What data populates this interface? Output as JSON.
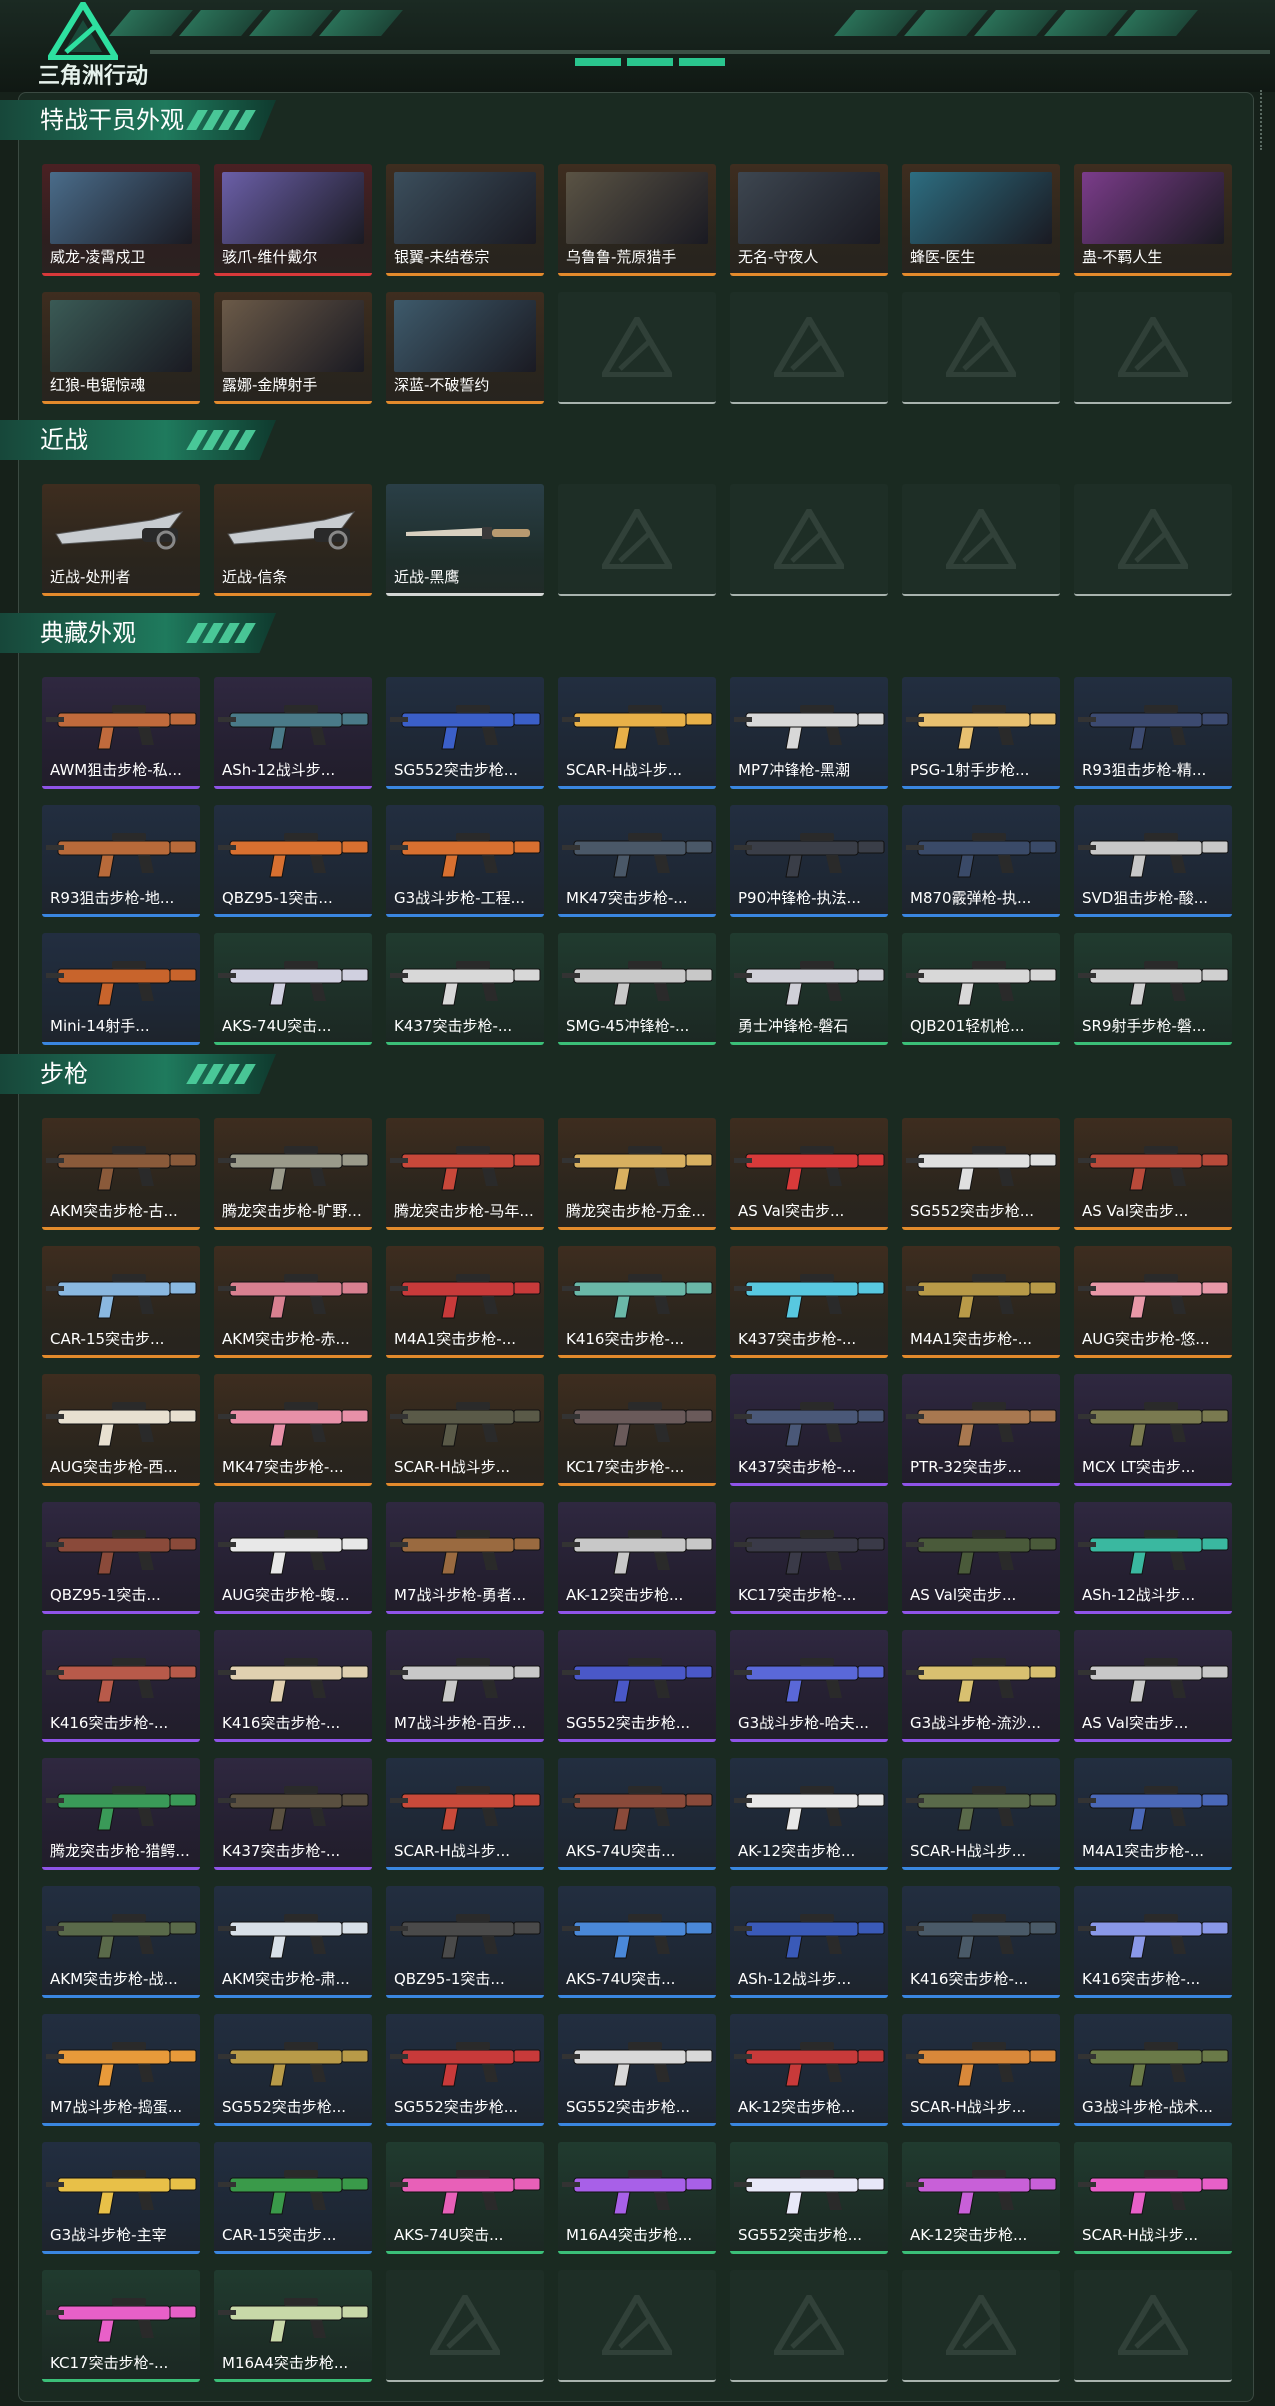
{
  "header": {
    "logo_text": "三角洲行动"
  },
  "sections": [
    {
      "title": "特战干员外观",
      "items": [
        {
          "name": "威龙-凌霄戍卫",
          "rarity": "red",
          "art": "#4a6c8a"
        },
        {
          "name": "骇爪-维什戴尔",
          "rarity": "red",
          "art": "#6b5fa8"
        },
        {
          "name": "银翼-未结卷宗",
          "rarity": "gold",
          "art": "#3b4e5c"
        },
        {
          "name": "乌鲁鲁-荒原猎手",
          "rarity": "gold",
          "art": "#5a5344"
        },
        {
          "name": "无名-守夜人",
          "rarity": "gold",
          "art": "#3d4650"
        },
        {
          "name": "蜂医-医生",
          "rarity": "gold",
          "art": "#2d6d80"
        },
        {
          "name": "蛊-不羁人生",
          "rarity": "gold",
          "art": "#7b3c8a"
        },
        {
          "name": "红狼-电锯惊魂",
          "rarity": "gold",
          "art": "#3a5a55"
        },
        {
          "name": "露娜-金牌射手",
          "rarity": "gold",
          "art": "#6b5a48"
        },
        {
          "name": "深蓝-不破誓约",
          "rarity": "gold",
          "art": "#3e5a6b"
        },
        null,
        null,
        null,
        null
      ]
    },
    {
      "title": "近战",
      "items": [
        {
          "name": "近战-处刑者",
          "rarity": "gold",
          "gun": "blade"
        },
        {
          "name": "近战-信条",
          "rarity": "gold",
          "gun": "blade"
        },
        {
          "name": "近战-黑鹰",
          "rarity": "white",
          "gun": "knife"
        },
        null,
        null,
        null,
        null
      ]
    },
    {
      "title": "典藏外观",
      "items": [
        {
          "name": "AWM狙击步枪-私...",
          "rarity": "purple",
          "color": "#c06a3c"
        },
        {
          "name": "ASh-12战斗步...",
          "rarity": "purple",
          "color": "#4a7a88"
        },
        {
          "name": "SG552突击步枪...",
          "rarity": "blue",
          "color": "#3b5fc8"
        },
        {
          "name": "SCAR-H战斗步...",
          "rarity": "blue",
          "color": "#e8b048"
        },
        {
          "name": "MP7冲锋枪-黑潮",
          "rarity": "blue",
          "color": "#d8d8d8"
        },
        {
          "name": "PSG-1射手步枪...",
          "rarity": "blue",
          "color": "#e8c070"
        },
        {
          "name": "R93狙击步枪-精...",
          "rarity": "blue",
          "color": "#3c4a70"
        },
        {
          "name": "R93狙击步枪-地...",
          "rarity": "blue",
          "color": "#b86a3a"
        },
        {
          "name": "QBZ95-1突击...",
          "rarity": "blue",
          "color": "#d87030"
        },
        {
          "name": "G3战斗步枪-工程...",
          "rarity": "blue",
          "color": "#d87030"
        },
        {
          "name": "MK47突击步枪-...",
          "rarity": "blue",
          "color": "#4a5868"
        },
        {
          "name": "P90冲锋枪-执法...",
          "rarity": "blue",
          "color": "#3a3e48"
        },
        {
          "name": "M870霰弹枪-执...",
          "rarity": "blue",
          "color": "#3a4a68"
        },
        {
          "name": "SVD狙击步枪-酸...",
          "rarity": "blue",
          "color": "#c8c8c8"
        },
        {
          "name": "Mini-14射手...",
          "rarity": "blue",
          "color": "#c8642c"
        },
        {
          "name": "AKS-74U突击...",
          "rarity": "green",
          "color": "#d0d0e0"
        },
        {
          "name": "K437突击步枪-...",
          "rarity": "green",
          "color": "#d8d8d8"
        },
        {
          "name": "SMG-45冲锋枪-...",
          "rarity": "green",
          "color": "#c8c8c8"
        },
        {
          "name": "勇士冲锋枪-磐石",
          "rarity": "green",
          "color": "#d0d0d8"
        },
        {
          "name": "QJB201轻机枪...",
          "rarity": "green",
          "color": "#d8d8d8"
        },
        {
          "name": "SR9射手步枪-磐...",
          "rarity": "green",
          "color": "#d0d0d0"
        }
      ]
    },
    {
      "title": "步枪",
      "items": [
        {
          "name": "AKM突击步枪-古...",
          "rarity": "gold",
          "color": "#8a5a3a"
        },
        {
          "name": "腾龙突击步枪-旷野...",
          "rarity": "gold",
          "color": "#9a9a8a"
        },
        {
          "name": "腾龙突击步枪-马年...",
          "rarity": "gold",
          "color": "#c8483a"
        },
        {
          "name": "腾龙突击步枪-万金...",
          "rarity": "gold",
          "color": "#d8b060"
        },
        {
          "name": "AS Val突击步...",
          "rarity": "gold",
          "color": "#d83a3a"
        },
        {
          "name": "SG552突击步枪...",
          "rarity": "gold",
          "color": "#e0e0e0"
        },
        {
          "name": "AS Val突击步...",
          "rarity": "gold",
          "color": "#b84a3a"
        },
        {
          "name": "CAR-15突击步...",
          "rarity": "gold",
          "color": "#8ab8e0"
        },
        {
          "name": "AKM突击步枪-赤...",
          "rarity": "gold",
          "color": "#d88090"
        },
        {
          "name": "M4A1突击步枪-...",
          "rarity": "gold",
          "color": "#c83a3a"
        },
        {
          "name": "K416突击步枪-...",
          "rarity": "gold",
          "color": "#6ab8a8"
        },
        {
          "name": "K437突击步枪-...",
          "rarity": "gold",
          "color": "#58c8e0"
        },
        {
          "name": "M4A1突击步枪-...",
          "rarity": "gold",
          "color": "#b89a48"
        },
        {
          "name": "AUG突击步枪-悠...",
          "rarity": "gold",
          "color": "#e898a8"
        },
        {
          "name": "AUG突击步枪-西...",
          "rarity": "gold",
          "color": "#e8e0d0"
        },
        {
          "name": "MK47突击步枪-...",
          "rarity": "gold",
          "color": "#e890a8"
        },
        {
          "name": "SCAR-H战斗步...",
          "rarity": "gold",
          "color": "#5a5a48"
        },
        {
          "name": "KC17突击步枪-...",
          "rarity": "gold",
          "color": "#6a5a5a"
        },
        {
          "name": "K437突击步枪-...",
          "rarity": "purple",
          "color": "#4a5878"
        },
        {
          "name": "PTR-32突击步...",
          "rarity": "purple",
          "color": "#a87850"
        },
        {
          "name": "MCX LT突击步...",
          "rarity": "purple",
          "color": "#7a7a50"
        },
        {
          "name": "QBZ95-1突击...",
          "rarity": "purple",
          "color": "#8a4a3a"
        },
        {
          "name": "AUG突击步枪-蝮...",
          "rarity": "purple",
          "color": "#e8e8e8"
        },
        {
          "name": "M7战斗步枪-勇者...",
          "rarity": "purple",
          "color": "#9a6a40"
        },
        {
          "name": "AK-12突击步枪...",
          "rarity": "purple",
          "color": "#c8c8c8"
        },
        {
          "name": "KC17突击步枪-...",
          "rarity": "purple",
          "color": "#3a3a48"
        },
        {
          "name": "AS Val突击步...",
          "rarity": "purple",
          "color": "#4a5a3a"
        },
        {
          "name": "ASh-12战斗步...",
          "rarity": "purple",
          "color": "#3ab8a0"
        },
        {
          "name": "K416突击步枪-...",
          "rarity": "purple",
          "color": "#b85a4a"
        },
        {
          "name": "K416突击步枪-...",
          "rarity": "purple",
          "color": "#e0d0b0"
        },
        {
          "name": "M7战斗步枪-百步...",
          "rarity": "purple",
          "color": "#c8c8c8"
        },
        {
          "name": "SG552突击步枪...",
          "rarity": "purple",
          "color": "#4a58c8"
        },
        {
          "name": "G3战斗步枪-哈夫...",
          "rarity": "purple",
          "color": "#5a68d8"
        },
        {
          "name": "G3战斗步枪-流沙...",
          "rarity": "purple",
          "color": "#d8c070"
        },
        {
          "name": "AS Val突击步...",
          "rarity": "purple",
          "color": "#c8c8c8"
        },
        {
          "name": "腾龙突击步枪-猎鳄...",
          "rarity": "purple",
          "color": "#3a9a58"
        },
        {
          "name": "K437突击步枪-...",
          "rarity": "purple",
          "color": "#5a5040"
        },
        {
          "name": "SCAR-H战斗步...",
          "rarity": "blue",
          "color": "#c84a3a"
        },
        {
          "name": "AKS-74U突击...",
          "rarity": "blue",
          "color": "#8a4a3a"
        },
        {
          "name": "AK-12突击步枪...",
          "rarity": "blue",
          "color": "#e8e8e8"
        },
        {
          "name": "SCAR-H战斗步...",
          "rarity": "blue",
          "color": "#5a6a4a"
        },
        {
          "name": "M4A1突击步枪-...",
          "rarity": "blue",
          "color": "#4a68b8"
        },
        {
          "name": "AKM突击步枪-战...",
          "rarity": "blue",
          "color": "#5a6a4a"
        },
        {
          "name": "AKM突击步枪-肃...",
          "rarity": "blue",
          "color": "#d8e0e8"
        },
        {
          "name": "QBZ95-1突击...",
          "rarity": "blue",
          "color": "#4a4a4a"
        },
        {
          "name": "AKS-74U突击...",
          "rarity": "blue",
          "color": "#4a88d8"
        },
        {
          "name": "ASh-12战斗步...",
          "rarity": "blue",
          "color": "#3a5ab8"
        },
        {
          "name": "K416突击步枪-...",
          "rarity": "blue",
          "color": "#4a5a68"
        },
        {
          "name": "K416突击步枪-...",
          "rarity": "blue",
          "color": "#8a98e8"
        },
        {
          "name": "M7战斗步枪-捣蛋...",
          "rarity": "blue",
          "color": "#e89a3a"
        },
        {
          "name": "SG552突击步枪...",
          "rarity": "blue",
          "color": "#b89a48"
        },
        {
          "name": "SG552突击步枪...",
          "rarity": "blue",
          "color": "#c83a3a"
        },
        {
          "name": "SG552突击步枪...",
          "rarity": "blue",
          "color": "#d8d8d8"
        },
        {
          "name": "AK-12突击步枪...",
          "rarity": "blue",
          "color": "#c83a3a"
        },
        {
          "name": "SCAR-H战斗步...",
          "rarity": "blue",
          "color": "#d8883a"
        },
        {
          "name": "G3战斗步枪-战术...",
          "rarity": "blue",
          "color": "#6a7a48"
        },
        {
          "name": "G3战斗步枪-主宰",
          "rarity": "blue",
          "color": "#e8c048"
        },
        {
          "name": "CAR-15突击步...",
          "rarity": "blue",
          "color": "#3a9a4a"
        },
        {
          "name": "AKS-74U突击...",
          "rarity": "green",
          "color": "#e860b8"
        },
        {
          "name": "M16A4突击步枪...",
          "rarity": "green",
          "color": "#a860e8"
        },
        {
          "name": "SG552突击步枪...",
          "rarity": "green",
          "color": "#e8e8f8"
        },
        {
          "name": "AK-12突击步枪...",
          "rarity": "green",
          "color": "#c860d8"
        },
        {
          "name": "SCAR-H战斗步...",
          "rarity": "green",
          "color": "#e860c8"
        },
        {
          "name": "KC17突击步枪-...",
          "rarity": "green",
          "color": "#e860c8"
        },
        {
          "name": "M16A4突击步枪...",
          "rarity": "green",
          "color": "#c8d8a8"
        },
        null,
        null,
        null,
        null,
        null
      ]
    }
  ]
}
